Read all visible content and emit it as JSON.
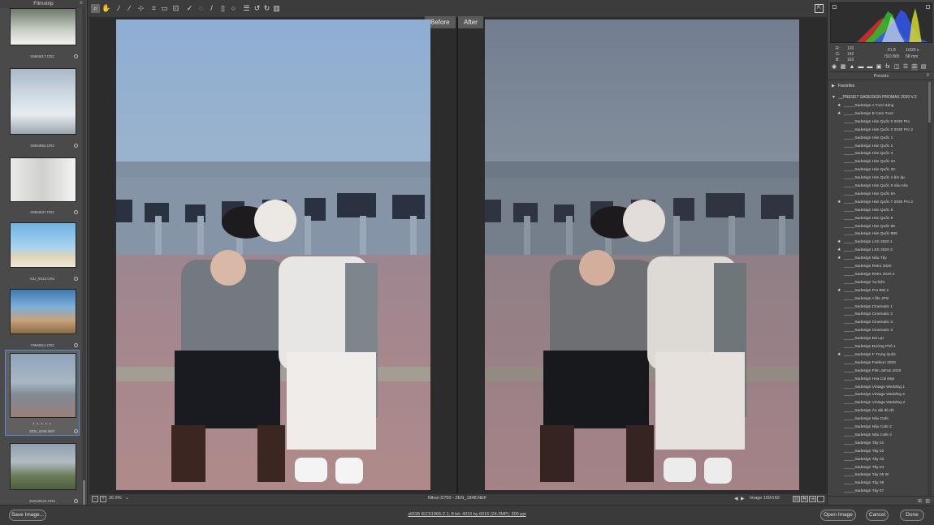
{
  "filmstrip": {
    "title": "Filmstrip",
    "items": [
      {
        "name": "X9M4617.CR2"
      },
      {
        "name": "X9M4652.CR2"
      },
      {
        "name": "X9M4647.CR2"
      },
      {
        "name": "X3J_9412.CR2"
      },
      {
        "name": "Y9M4811.CR2"
      },
      {
        "name": "ZEN_1848.NEF",
        "dots": "• • • • •"
      },
      {
        "name": "ZUKZ9110.CR2"
      }
    ]
  },
  "toolbar": {
    "icons": [
      "zoom-icon",
      "hand-icon",
      "white-balance-icon",
      "color-sampler-icon",
      "targeted-adjust-icon",
      "crop-icon",
      "straighten-icon",
      "transform-icon",
      "spot-removal-icon",
      "red-eye-icon",
      "adjustment-brush-icon",
      "graduated-filter-icon",
      "radial-filter-icon",
      "preferences-icon",
      "rotate-ccw-icon",
      "rotate-cw-icon",
      "trash-icon"
    ],
    "full_screen_icon": "full-screen-icon"
  },
  "preview": {
    "before_label": "Before",
    "after_label": "After"
  },
  "status": {
    "zoom": "26.9%",
    "camera_file": "Nikon D750  -  ZEN_1848.NEF",
    "image_counter": "Image 159/160"
  },
  "histogram": {
    "readout": {
      "r_label": "R:",
      "g_label": "G:",
      "b_label": "B:",
      "r": "120",
      "g": "142",
      "b": "162"
    },
    "aperture": "f/1.8",
    "shutter": "1/320 s",
    "iso": "ISO 800",
    "focal": "58 mm"
  },
  "presets": {
    "title": "Presets",
    "favorites": "Favorites",
    "group": "__PRESET SADESIGN PROMAX 2020 V.2",
    "items": [
      {
        "label": "_____Sadesign A Tươi Sáng",
        "star": true
      },
      {
        "label": "_____Sadesign B  Cam Tươi",
        "star": true
      },
      {
        "label": "_____Sadesign Hàn Quốc 0 2020 Pro",
        "star": false
      },
      {
        "label": "_____Sadesign Hàn Quốc 0 2020 Pro 2",
        "star": false
      },
      {
        "label": "_____Sadesign Hàn Quốc 1",
        "star": false
      },
      {
        "label": "_____Sadesign Hàn Quốc 2",
        "star": false
      },
      {
        "label": "_____Sadesign Hàn Quốc 3",
        "star": false
      },
      {
        "label": "_____Sadesign Hàn Quốc 3A",
        "star": false
      },
      {
        "label": "_____Sadesign Hàn Quốc 3C",
        "star": false
      },
      {
        "label": "_____Sadesign Hàn Quốc 4 ấm áp",
        "star": false
      },
      {
        "label": "_____Sadesign Hàn Quốc 5 nâu nhẹ",
        "star": false
      },
      {
        "label": "_____Sadesign Hàn Quốc 6A",
        "star": false
      },
      {
        "label": "_____Sadesign Hàn Quốc 7 2020 Pro 2",
        "star": true
      },
      {
        "label": "_____Sadesign Hàn Quốc 8",
        "star": false
      },
      {
        "label": "_____Sadesign Hàn Quốc 9",
        "star": false
      },
      {
        "label": "_____Sadesign Hàn Quốc 99",
        "star": false
      },
      {
        "label": "_____Sadesign Hàn Quốc 999",
        "star": false
      },
      {
        "label": "_____Sadesign LXS 2020 1",
        "star": true
      },
      {
        "label": "_____Sadesign LXS 2020 3",
        "star": true
      },
      {
        "label": "_____Sadesign Nâu Tây",
        "star": true
      },
      {
        "label": "_____Sadesign Retro 2020",
        "star": false
      },
      {
        "label": "_____Sadesign Retro 2020 2",
        "star": false
      },
      {
        "label": "_____Sadesign Tạ hiện",
        "star": false
      },
      {
        "label": "_____Sadesign Pro BW 2",
        "star": true
      },
      {
        "label": "_____Sadesign A file JPG",
        "star": false
      },
      {
        "label": "_____Sadesign Cinematic 1",
        "star": false
      },
      {
        "label": "_____Sadesign Cinematic 2",
        "star": false
      },
      {
        "label": "_____Sadesign Cinematic 3",
        "star": false
      },
      {
        "label": "_____Sadesign Cinematic 3",
        "star": false
      },
      {
        "label": "_____Sadesign Đà Lạt",
        "star": false
      },
      {
        "label": "_____Sadesign Đường Phố 1",
        "star": false
      },
      {
        "label": "_____Sadesign F Trung Quốc",
        "star": true
      },
      {
        "label": "_____Sadesign Fashion 2020",
        "star": false
      },
      {
        "label": "_____Sadesign Film JaFan 2020",
        "star": false
      },
      {
        "label": "_____Sadesign Hoa Cái Đẹp",
        "star": false
      },
      {
        "label": "_____Sadesign Vintage Wedding 1",
        "star": false
      },
      {
        "label": "_____Sadesign Vintage Wedding 2",
        "star": false
      },
      {
        "label": "_____Sadesign Vintage Wedding 3",
        "star": false
      },
      {
        "label": "_____Sadesign Áo dài đỏ đỏ",
        "star": false
      },
      {
        "label": "_____Sadesign Nâu Cafe",
        "star": false
      },
      {
        "label": "_____Sadesign Nâu Cafe 2",
        "star": false
      },
      {
        "label": "_____Sadesign Nâu Cafe 3",
        "star": false
      },
      {
        "label": "_____Sadesign Tây 01",
        "star": false
      },
      {
        "label": "_____Sadesign Tây 02",
        "star": false
      },
      {
        "label": "_____Sadesign Tây 03",
        "star": false
      },
      {
        "label": "_____Sadesign Tây 04",
        "star": false
      },
      {
        "label": "_____Sadesign Tây 05 W",
        "star": false
      },
      {
        "label": "_____Sadesign Tây 06",
        "star": false
      },
      {
        "label": "_____Sadesign Tây 07",
        "star": false
      }
    ]
  },
  "bottom": {
    "save_label": "Save Image...",
    "workflow": "sRGB IEC61966-2.1; 8 bit; 4016 by 6016 (24.2MP); 300 ppi",
    "open_label": "Open Image",
    "cancel_label": "Cancel",
    "done_label": "Done"
  },
  "colors": {
    "accent": "#5a8cd6",
    "panel": "#434343",
    "background": "#3c3c3c"
  }
}
